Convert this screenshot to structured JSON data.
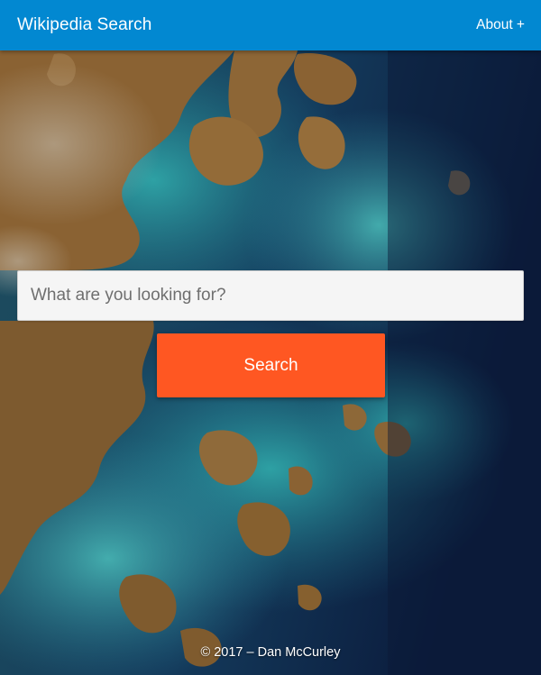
{
  "navbar": {
    "brand": "Wikipedia Search",
    "about_label": "About +",
    "background_color": "#0288d1"
  },
  "search": {
    "placeholder": "What are you looking for?",
    "value": "",
    "button_label": "Search",
    "button_color": "#ff5722"
  },
  "footer": {
    "text": "© 2017 – Dan McCurley"
  },
  "background": {
    "description_icon": "satellite-coastline-image"
  }
}
